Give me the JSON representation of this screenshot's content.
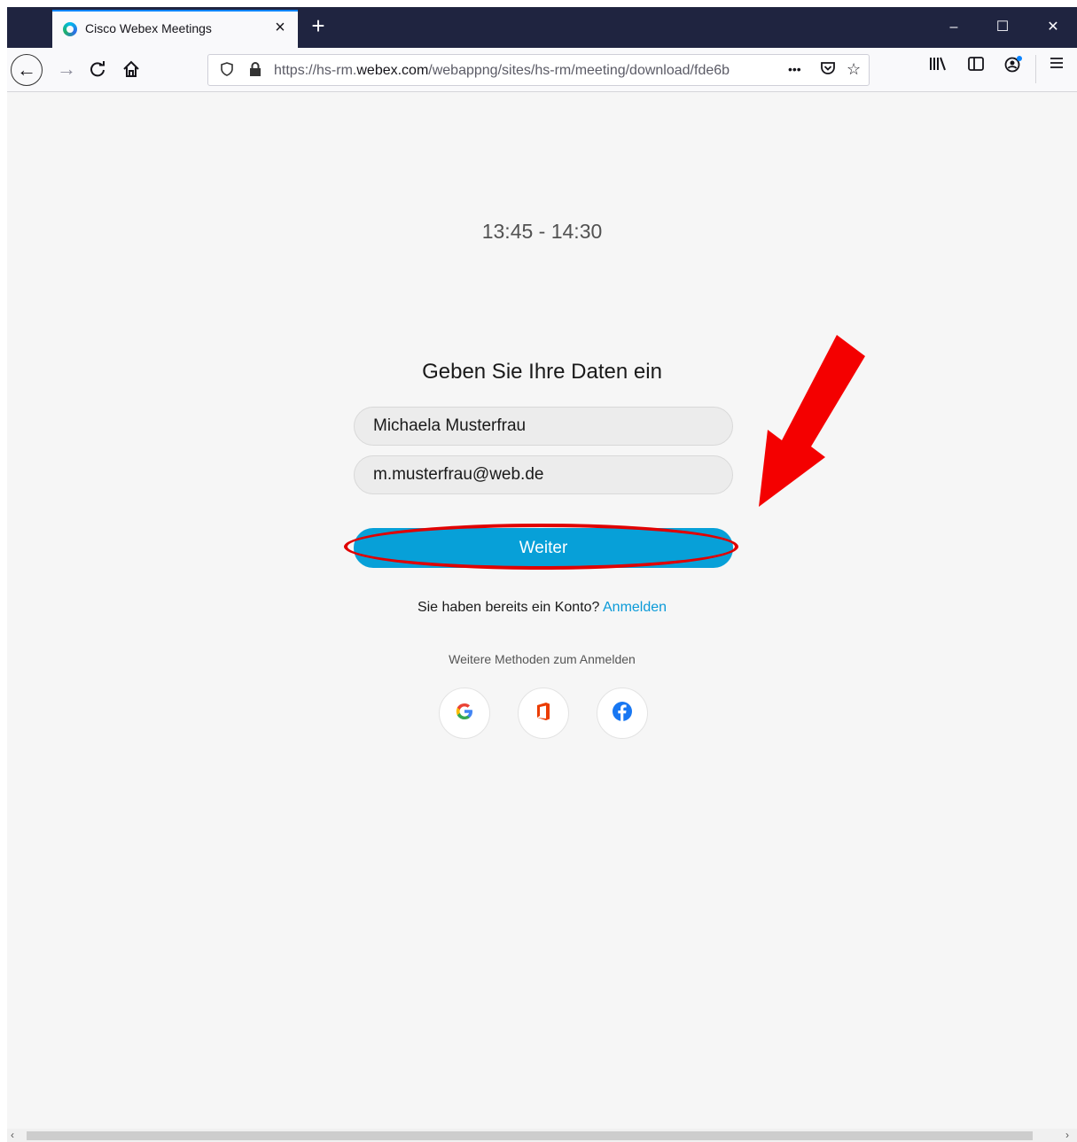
{
  "browser": {
    "tab_title": "Cisco Webex Meetings",
    "tab_close": "×",
    "new_tab": "+",
    "url_prefix": "https://hs-rm.",
    "url_domain": "webex.com",
    "url_rest": "/webappng/sites/hs-rm/meeting/download/fde6b",
    "page_actions": "•••",
    "window_controls": [
      "–",
      "☐",
      "✕"
    ]
  },
  "page": {
    "time_range": "13:45 - 14:30",
    "form_title": "Geben Sie Ihre Daten ein",
    "name_value": "Michaela Musterfrau",
    "email_value": "m.musterfrau@web.de",
    "submit_label": "Weiter",
    "account_prompt": "Sie haben bereits ein Konto?",
    "sign_in_link": "Anmelden",
    "more_methods": "Weitere Methoden zum Anmelden",
    "social_providers": [
      "google-icon",
      "office-icon",
      "facebook-icon"
    ]
  },
  "colors": {
    "accent": "#07a0d8",
    "annotation": "#e00000"
  }
}
